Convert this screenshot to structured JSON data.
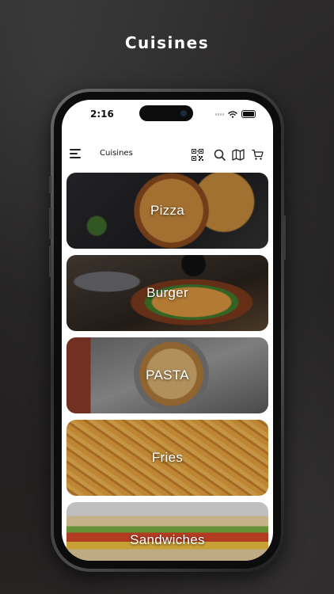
{
  "promo": {
    "title": "Cuisines"
  },
  "status_bar": {
    "time": "2:16"
  },
  "header": {
    "title": "Cuisines"
  },
  "cuisines": [
    {
      "label": "Pizza"
    },
    {
      "label": "Burger"
    },
    {
      "label": "PASTA"
    },
    {
      "label": "Fries"
    },
    {
      "label": "Sandwiches"
    }
  ],
  "icons": {
    "menu": "menu-icon",
    "qr": "qr-code-icon",
    "search": "search-icon",
    "map": "map-icon",
    "cart": "cart-icon"
  },
  "colors": {
    "background": "#221f1f",
    "screen": "#ffffff",
    "text_on_card": "#ffffff"
  }
}
